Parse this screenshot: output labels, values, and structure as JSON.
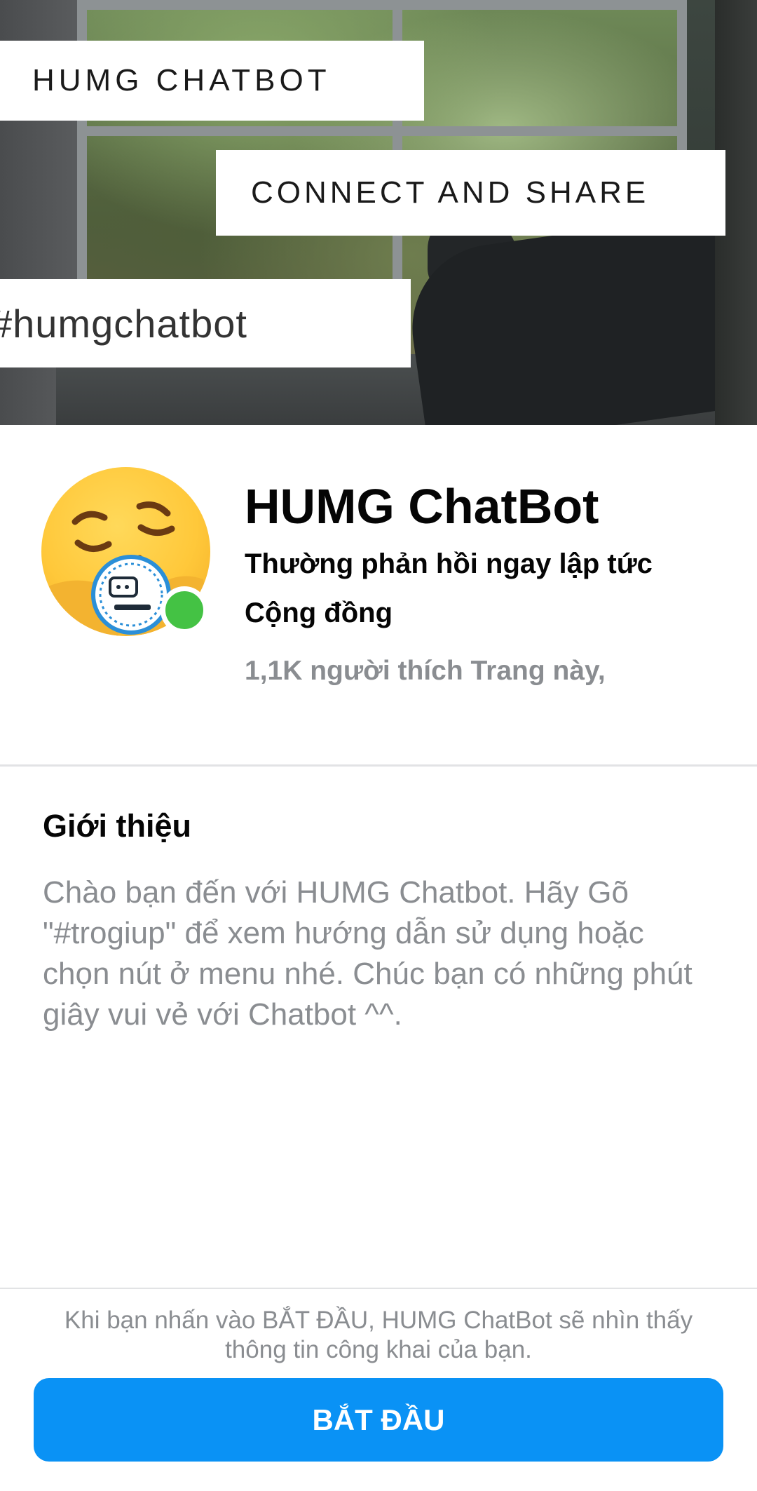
{
  "cover": {
    "title_banner": "HUMG CHATBOT",
    "tagline_banner": "CONNECT AND SHARE",
    "hashtag_banner": "#humgchatbot"
  },
  "profile": {
    "name": "HUMG ChatBot",
    "response_time": "Thường phản hồi ngay lập tức",
    "category": "Cộng đồng",
    "likes": "1,1K người thích Trang này,",
    "status": "online",
    "status_color": "#44c244"
  },
  "about": {
    "heading": "Giới thiệu",
    "text": "Chào bạn đến với HUMG Chatbot. Hãy Gõ \"#trogiup\" để xem hướng dẫn sử dụng hoặc chọn nút ở menu nhé. Chúc bạn có những phút giây vui vẻ với Chatbot ^^."
  },
  "footer": {
    "note": "Khi bạn nhấn vào BẮT ĐẦU, HUMG ChatBot sẽ nhìn thấy thông tin công khai của bạn.",
    "start_label": "BẮT ĐẦU",
    "button_color": "#0a92f5"
  }
}
